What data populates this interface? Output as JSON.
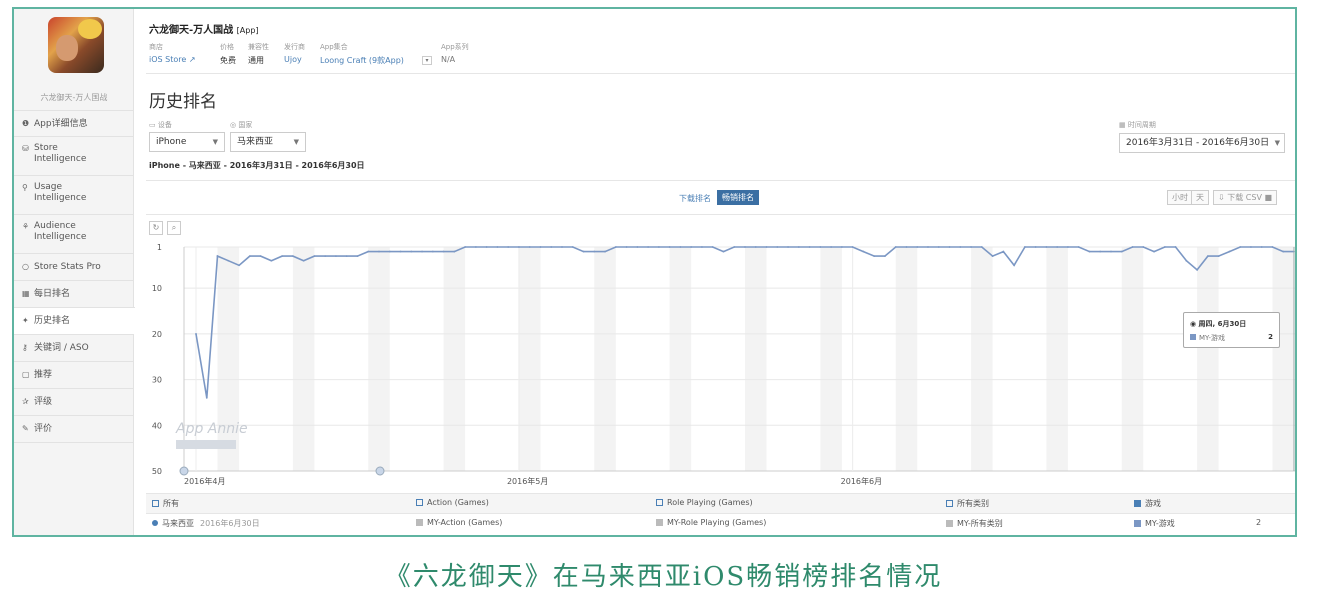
{
  "app": {
    "name": "六龙御天-万人国战",
    "type_tag": "[App]",
    "sidebar_name": "六龙御天-万人国战"
  },
  "meta": {
    "labels": [
      "商店",
      "价格",
      "兼容性",
      "发行商",
      "App集合",
      "App系列"
    ],
    "store": "iOS Store",
    "price": "免费",
    "compat": "通用",
    "publisher": "Ujoy",
    "collection": "Loong Craft (9款App)",
    "series": "N/A"
  },
  "sidebar": {
    "items": [
      {
        "icon": "❶",
        "label": "App详细信息"
      },
      {
        "icon": "⛁",
        "label": "Store",
        "label2": "Intelligence"
      },
      {
        "icon": "⚲",
        "label": "Usage",
        "label2": "Intelligence"
      },
      {
        "icon": "⚘",
        "label": "Audience",
        "label2": "Intelligence"
      },
      {
        "icon": "○",
        "label": "Store Stats Pro"
      },
      {
        "icon": "▦",
        "label": "每日排名"
      },
      {
        "icon": "✦",
        "label": "历史排名"
      },
      {
        "icon": "⚷",
        "label": "关键词 / ASO"
      },
      {
        "icon": "▢",
        "label": "推荐"
      },
      {
        "icon": "✰",
        "label": "评级"
      },
      {
        "icon": "✎",
        "label": "评价"
      }
    ]
  },
  "page": {
    "title": "历史排名",
    "device_label": "设备",
    "device_value": "iPhone",
    "country_label": "国家",
    "country_value": "马来西亚",
    "date_label": "时间周期",
    "date_value": "2016年3月31日 - 2016年6月30日",
    "subtitle": "iPhone - 马来西亚 - 2016年3月31日 - 2016年6月30日",
    "toggle_download": "下载排名",
    "toggle_grossing": "畅销排名",
    "btn_hour": "小时",
    "btn_day": "天",
    "btn_csv": "下载 CSV"
  },
  "chart_data": {
    "type": "line",
    "y_reversed": true,
    "ylim": [
      1,
      50
    ],
    "y_ticks": [
      "1",
      "10",
      "20",
      "30",
      "40",
      "50"
    ],
    "x_ticks": [
      "2016年4月",
      "2016年5月",
      "2016年6月"
    ],
    "series": [
      {
        "name": "MY-游戏",
        "color": "#7b97c4",
        "values": [
          20,
          34,
          3,
          4,
          5,
          3,
          3,
          4,
          3,
          3,
          4,
          3,
          3,
          3,
          3,
          3,
          2,
          2,
          2,
          2,
          2,
          2,
          2,
          2,
          2,
          1,
          1,
          1,
          1,
          1,
          1,
          1,
          1,
          1,
          1,
          1,
          2,
          2,
          2,
          1,
          1,
          1,
          1,
          1,
          1,
          1,
          1,
          1,
          1,
          2,
          1,
          1,
          1,
          1,
          1,
          1,
          1,
          1,
          1,
          1,
          1,
          1,
          2,
          3,
          3,
          1,
          1,
          1,
          1,
          1,
          1,
          1,
          1,
          1,
          3,
          2,
          5,
          1,
          1,
          1,
          1,
          1,
          1,
          2,
          2,
          2,
          2,
          1,
          1,
          2,
          1,
          1,
          4,
          6,
          3,
          3,
          2,
          1,
          1,
          1,
          1,
          2,
          2
        ]
      }
    ],
    "tooltip": {
      "date": "周四, 6月30日",
      "series": "MY-游戏",
      "value": "2"
    },
    "watermark": "App Annie"
  },
  "legend": {
    "row1": [
      "所有",
      "Action (Games)",
      "Role Playing (Games)",
      "所有类别",
      "游戏"
    ],
    "row2_country": "马来西亚",
    "row2_date": "2016年6月30日",
    "row2_series": [
      "MY-Action (Games)",
      "MY-Role Playing (Games)",
      "MY-所有类别",
      "MY-游戏"
    ],
    "row2_value": "2"
  },
  "caption": "《六龙御天》在马来西亚iOS畅销榜排名情况"
}
